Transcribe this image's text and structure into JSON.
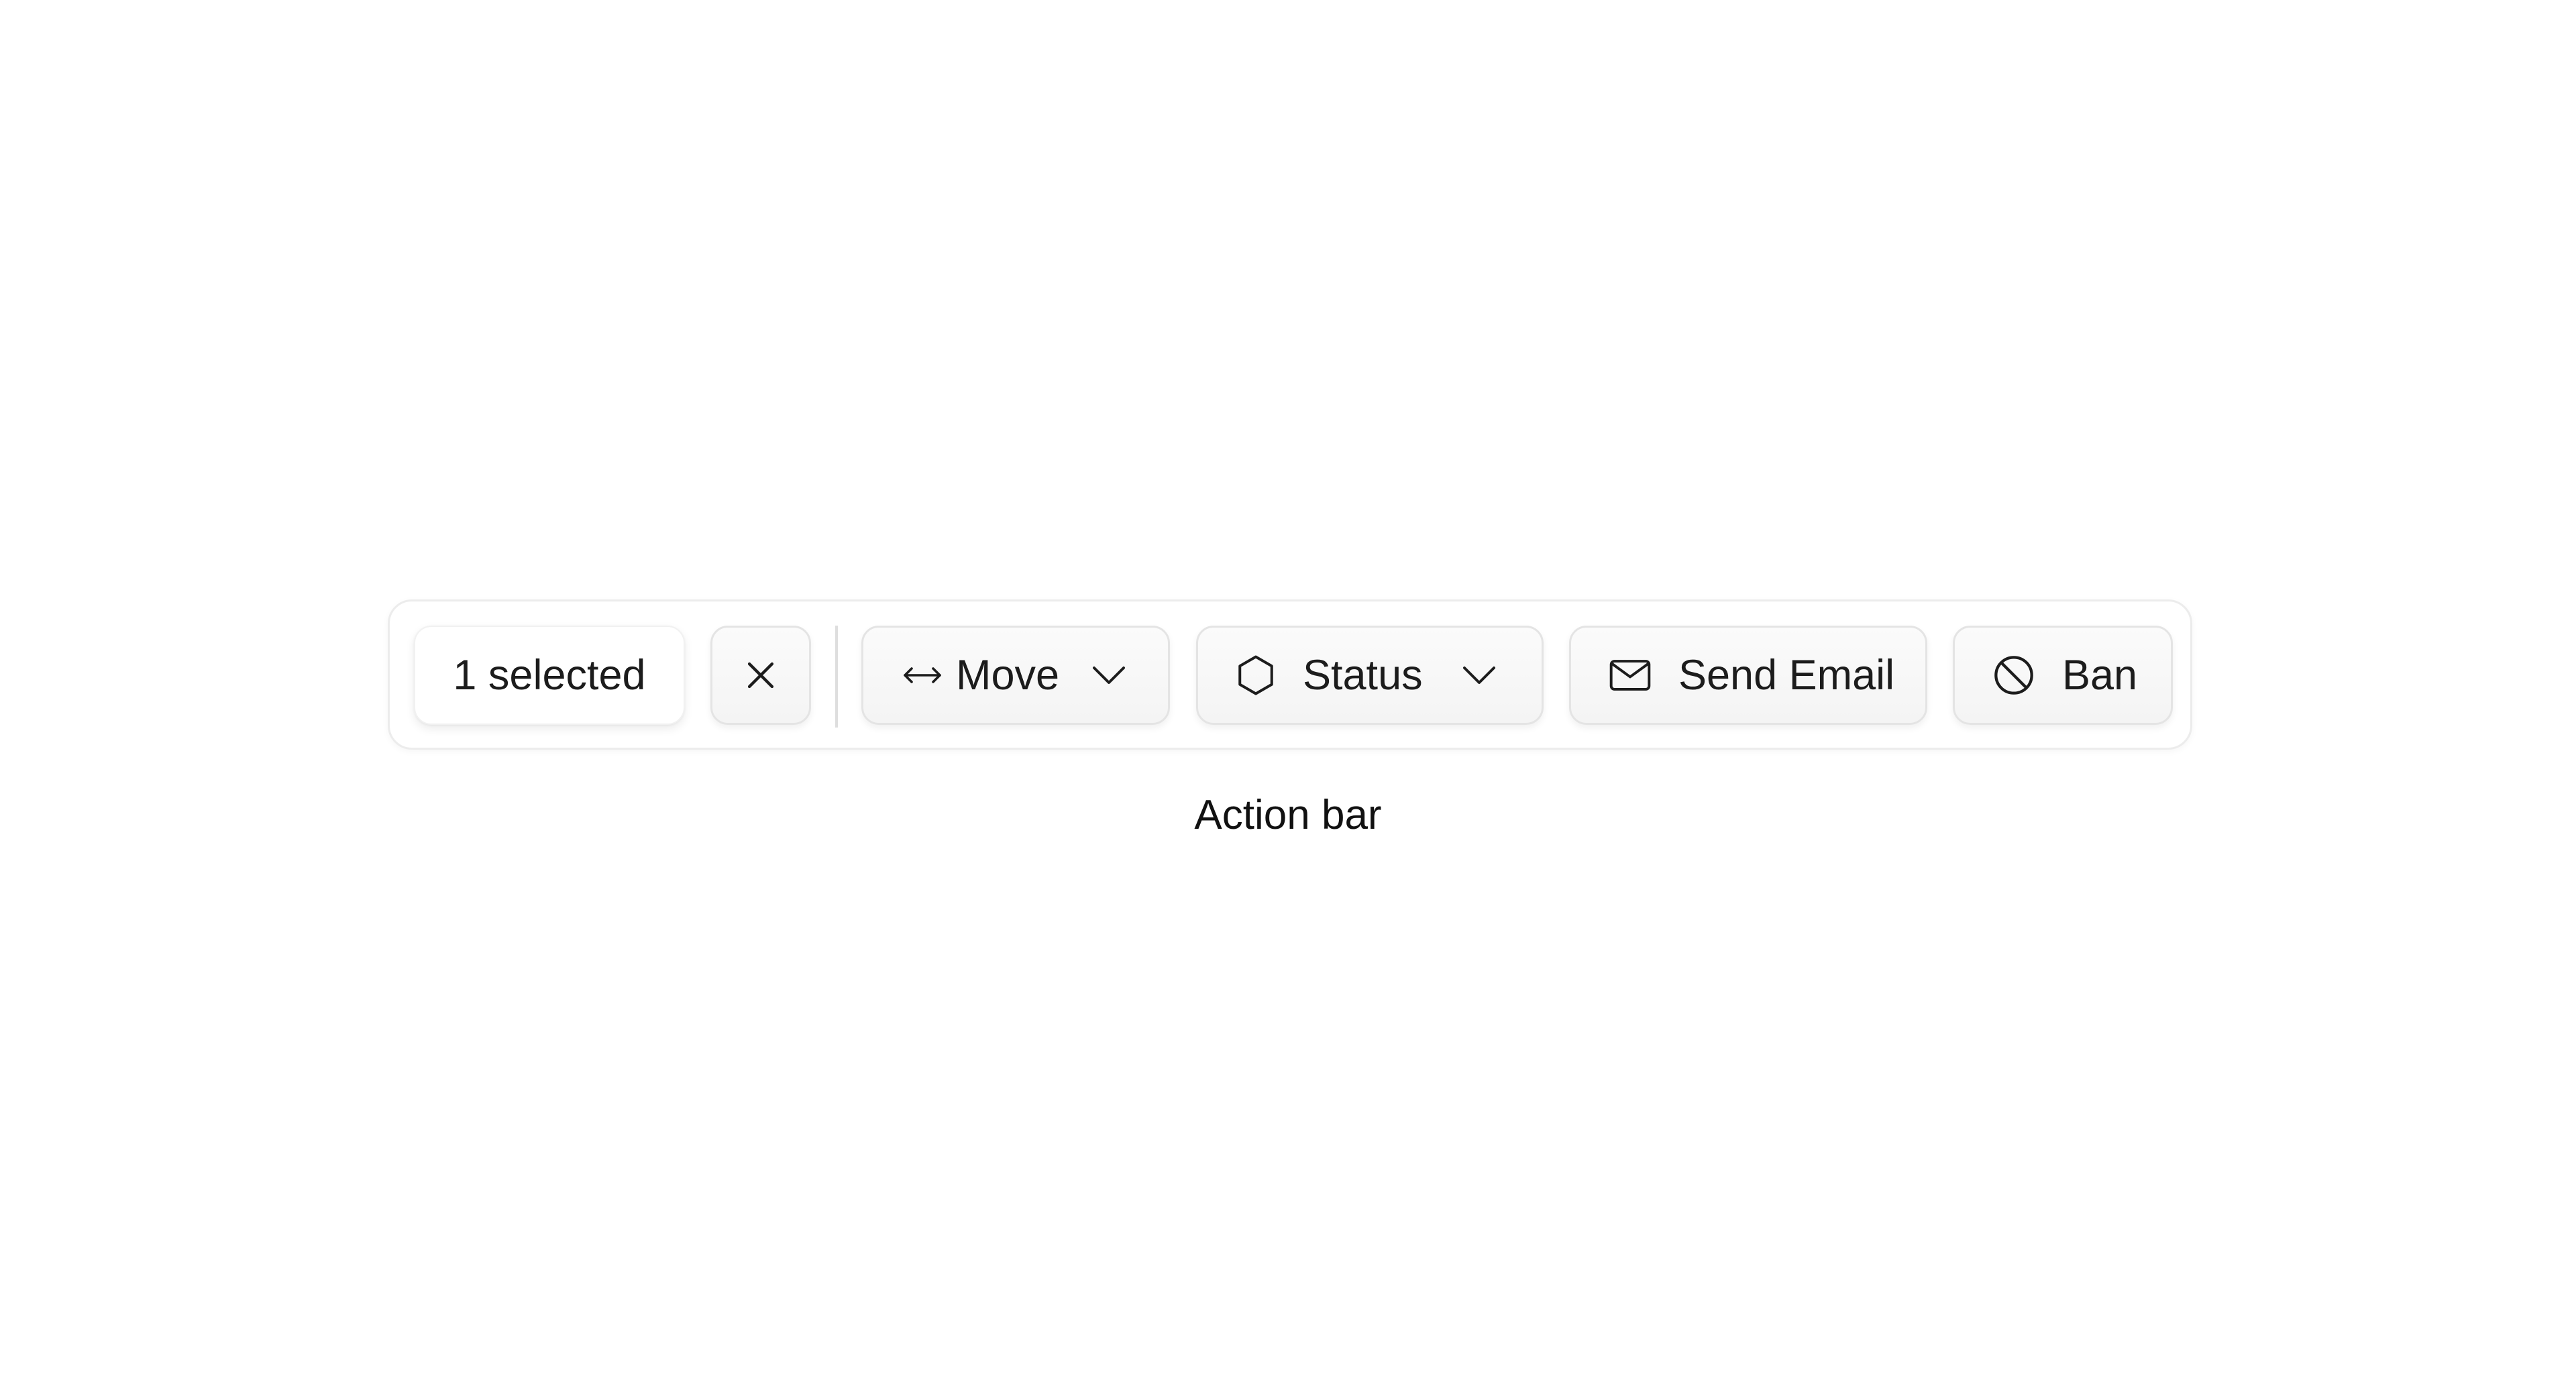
{
  "action_bar": {
    "selection_count_label": "1 selected",
    "clear_icon": "close-icon",
    "actions": [
      {
        "label": "Move",
        "icon": "arrows-horizontal-icon",
        "has_dropdown": true
      },
      {
        "label": "Status",
        "icon": "hexagon-icon",
        "has_dropdown": true
      },
      {
        "label": "Send Email",
        "icon": "mail-icon",
        "has_dropdown": false
      },
      {
        "label": "Ban",
        "icon": "ban-icon",
        "has_dropdown": false
      }
    ]
  },
  "caption": "Action bar",
  "colors": {
    "background": "#ffffff",
    "text": "#1c1c1c",
    "border": "#e4e4e4"
  }
}
